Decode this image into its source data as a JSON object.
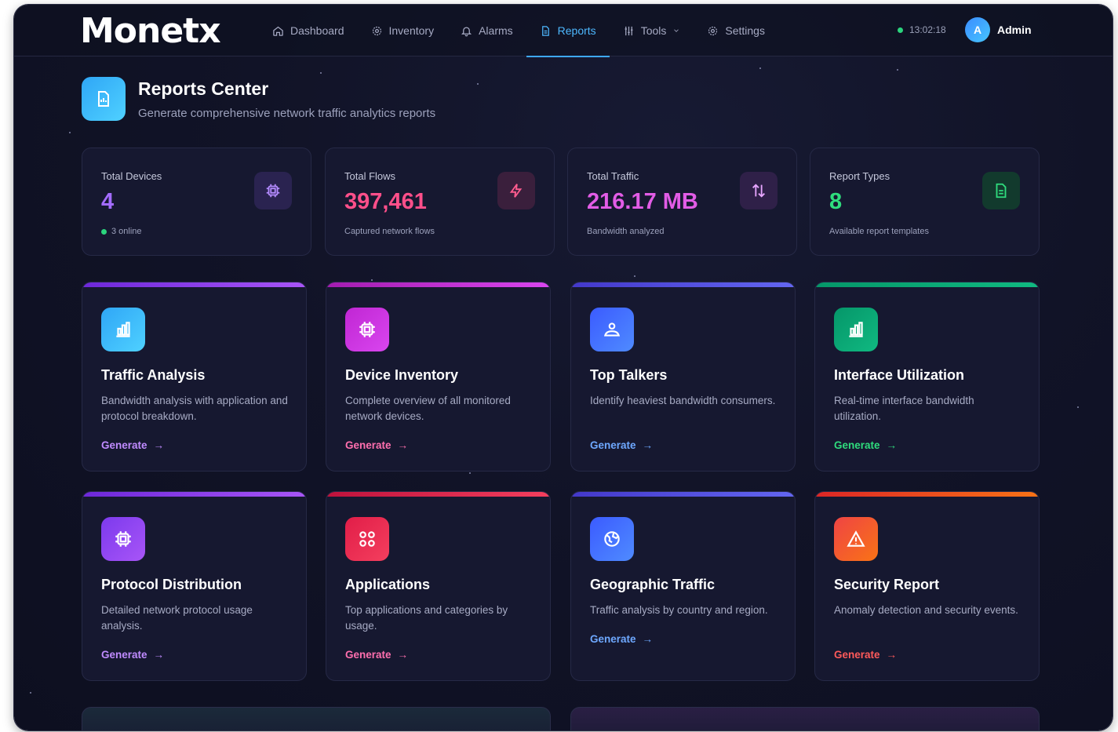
{
  "app": {
    "logo": "Monetx"
  },
  "nav": {
    "items": [
      {
        "label": "Dashboard",
        "icon": "home-icon"
      },
      {
        "label": "Inventory",
        "icon": "gear-icon"
      },
      {
        "label": "Alarms",
        "icon": "bell-icon"
      },
      {
        "label": "Reports",
        "icon": "document-icon",
        "active": true
      },
      {
        "label": "Tools",
        "icon": "sliders-icon",
        "has_dropdown": true
      },
      {
        "label": "Settings",
        "icon": "settings-icon"
      }
    ],
    "clock": "13:02:18",
    "user": {
      "initial": "A",
      "name": "Admin"
    }
  },
  "header": {
    "title": "Reports Center",
    "subtitle": "Generate comprehensive network traffic analytics reports"
  },
  "stats": [
    {
      "label": "Total Devices",
      "value": "4",
      "note": "3 online",
      "color": "#a36cff",
      "icon": "chip-icon"
    },
    {
      "label": "Total Flows",
      "value": "397,461",
      "note": "Captured network flows",
      "color": "#ff4f8a",
      "icon": "lightning-icon"
    },
    {
      "label": "Total Traffic",
      "value": "216.17 MB",
      "note": "Bandwidth analyzed",
      "color": "#e25ce6",
      "icon": "arrows-updown-icon"
    },
    {
      "label": "Report Types",
      "value": "8",
      "note": "Available report templates",
      "color": "#2fdc7d",
      "icon": "file-icon"
    }
  ],
  "reports": [
    {
      "title": "Traffic Analysis",
      "desc": "Bandwidth analysis with application and protocol breakdown.",
      "action": "Generate",
      "accent": "#7c3aed",
      "link": "#c08bff",
      "icon": "bar-chart-icon"
    },
    {
      "title": "Device Inventory",
      "desc": "Complete overview of all monitored network devices.",
      "action": "Generate",
      "accent": "#c026d3",
      "link": "#ff6fae",
      "icon": "chip-icon"
    },
    {
      "title": "Top Talkers",
      "desc": "Identify heaviest bandwidth consumers.",
      "action": "Generate",
      "accent": "#4f46e5",
      "link": "#6ea8ff",
      "icon": "users-icon"
    },
    {
      "title": "Interface Utilization",
      "desc": "Real-time interface bandwidth utilization.",
      "action": "Generate",
      "accent": "#10a36b",
      "link": "#2fdc7d",
      "icon": "bar-chart-icon"
    },
    {
      "title": "Protocol Distribution",
      "desc": "Detailed network protocol usage analysis.",
      "action": "Generate",
      "accent": "#7c3aed",
      "link": "#c08bff",
      "icon": "chip-icon"
    },
    {
      "title": "Applications",
      "desc": "Top applications and categories by usage.",
      "action": "Generate",
      "accent": "#e11d48",
      "link": "#ff6fae",
      "icon": "grid-icon"
    },
    {
      "title": "Geographic Traffic",
      "desc": "Traffic analysis by country and region.",
      "action": "Generate",
      "accent": "#4f46e5",
      "link": "#6ea8ff",
      "icon": "globe-icon"
    },
    {
      "title": "Security Report",
      "desc": "Anomaly detection and security events.",
      "action": "Generate",
      "accent": "#ea580c",
      "link": "#ff5a5a",
      "icon": "warning-icon"
    }
  ]
}
